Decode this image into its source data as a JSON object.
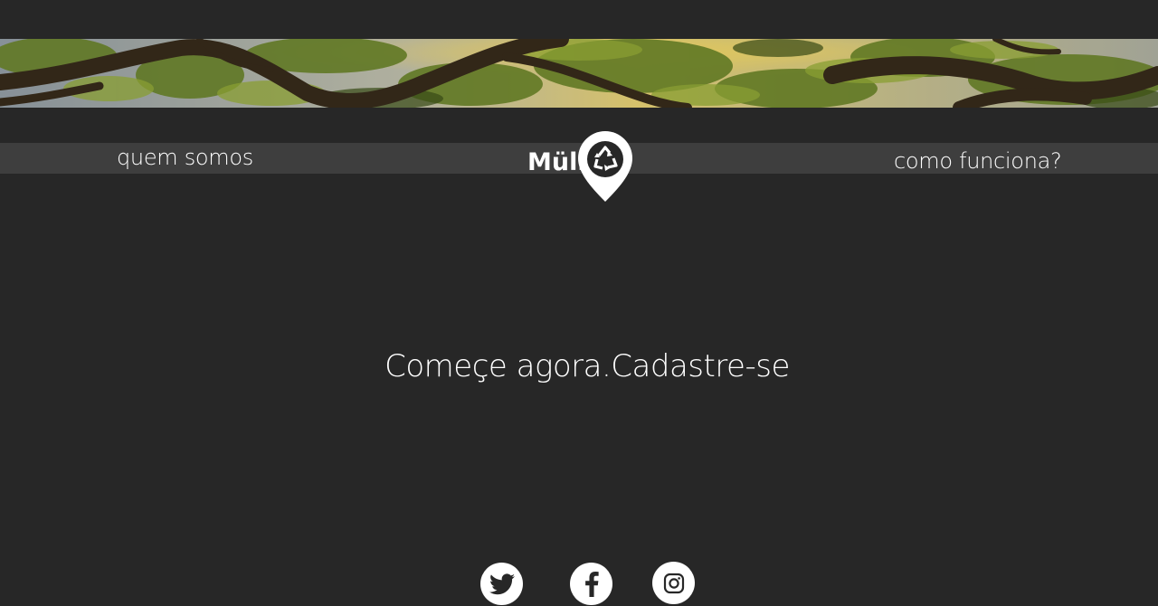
{
  "nav": {
    "left_link": "quem somos",
    "right_link": "como funciona?"
  },
  "logo": {
    "text": "Müll",
    "icon": "recycle-map-pin-icon"
  },
  "hero": {
    "image": "tree-canopy-sunlight-banner"
  },
  "cta": {
    "lead": "Começe agora.",
    "link": "Cadastre-se"
  },
  "social": [
    {
      "icon": "twitter-icon"
    },
    {
      "icon": "facebook-icon"
    },
    {
      "icon": "instagram-icon"
    }
  ],
  "colors": {
    "background": "#272727",
    "nav_bar": "#3e3e3e",
    "text": "#ffffff"
  }
}
